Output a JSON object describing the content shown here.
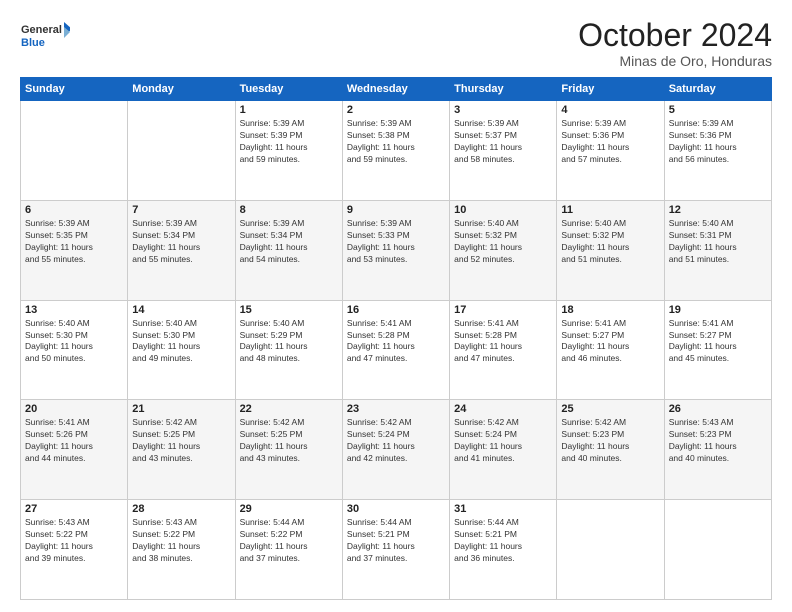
{
  "logo": {
    "line1": "General",
    "line2": "Blue"
  },
  "header": {
    "month": "October 2024",
    "location": "Minas de Oro, Honduras"
  },
  "weekdays": [
    "Sunday",
    "Monday",
    "Tuesday",
    "Wednesday",
    "Thursday",
    "Friday",
    "Saturday"
  ],
  "weeks": [
    [
      {
        "day": "",
        "content": ""
      },
      {
        "day": "",
        "content": ""
      },
      {
        "day": "1",
        "content": "Sunrise: 5:39 AM\nSunset: 5:39 PM\nDaylight: 11 hours\nand 59 minutes."
      },
      {
        "day": "2",
        "content": "Sunrise: 5:39 AM\nSunset: 5:38 PM\nDaylight: 11 hours\nand 59 minutes."
      },
      {
        "day": "3",
        "content": "Sunrise: 5:39 AM\nSunset: 5:37 PM\nDaylight: 11 hours\nand 58 minutes."
      },
      {
        "day": "4",
        "content": "Sunrise: 5:39 AM\nSunset: 5:36 PM\nDaylight: 11 hours\nand 57 minutes."
      },
      {
        "day": "5",
        "content": "Sunrise: 5:39 AM\nSunset: 5:36 PM\nDaylight: 11 hours\nand 56 minutes."
      }
    ],
    [
      {
        "day": "6",
        "content": "Sunrise: 5:39 AM\nSunset: 5:35 PM\nDaylight: 11 hours\nand 55 minutes."
      },
      {
        "day": "7",
        "content": "Sunrise: 5:39 AM\nSunset: 5:34 PM\nDaylight: 11 hours\nand 55 minutes."
      },
      {
        "day": "8",
        "content": "Sunrise: 5:39 AM\nSunset: 5:34 PM\nDaylight: 11 hours\nand 54 minutes."
      },
      {
        "day": "9",
        "content": "Sunrise: 5:39 AM\nSunset: 5:33 PM\nDaylight: 11 hours\nand 53 minutes."
      },
      {
        "day": "10",
        "content": "Sunrise: 5:40 AM\nSunset: 5:32 PM\nDaylight: 11 hours\nand 52 minutes."
      },
      {
        "day": "11",
        "content": "Sunrise: 5:40 AM\nSunset: 5:32 PM\nDaylight: 11 hours\nand 51 minutes."
      },
      {
        "day": "12",
        "content": "Sunrise: 5:40 AM\nSunset: 5:31 PM\nDaylight: 11 hours\nand 51 minutes."
      }
    ],
    [
      {
        "day": "13",
        "content": "Sunrise: 5:40 AM\nSunset: 5:30 PM\nDaylight: 11 hours\nand 50 minutes."
      },
      {
        "day": "14",
        "content": "Sunrise: 5:40 AM\nSunset: 5:30 PM\nDaylight: 11 hours\nand 49 minutes."
      },
      {
        "day": "15",
        "content": "Sunrise: 5:40 AM\nSunset: 5:29 PM\nDaylight: 11 hours\nand 48 minutes."
      },
      {
        "day": "16",
        "content": "Sunrise: 5:41 AM\nSunset: 5:28 PM\nDaylight: 11 hours\nand 47 minutes."
      },
      {
        "day": "17",
        "content": "Sunrise: 5:41 AM\nSunset: 5:28 PM\nDaylight: 11 hours\nand 47 minutes."
      },
      {
        "day": "18",
        "content": "Sunrise: 5:41 AM\nSunset: 5:27 PM\nDaylight: 11 hours\nand 46 minutes."
      },
      {
        "day": "19",
        "content": "Sunrise: 5:41 AM\nSunset: 5:27 PM\nDaylight: 11 hours\nand 45 minutes."
      }
    ],
    [
      {
        "day": "20",
        "content": "Sunrise: 5:41 AM\nSunset: 5:26 PM\nDaylight: 11 hours\nand 44 minutes."
      },
      {
        "day": "21",
        "content": "Sunrise: 5:42 AM\nSunset: 5:25 PM\nDaylight: 11 hours\nand 43 minutes."
      },
      {
        "day": "22",
        "content": "Sunrise: 5:42 AM\nSunset: 5:25 PM\nDaylight: 11 hours\nand 43 minutes."
      },
      {
        "day": "23",
        "content": "Sunrise: 5:42 AM\nSunset: 5:24 PM\nDaylight: 11 hours\nand 42 minutes."
      },
      {
        "day": "24",
        "content": "Sunrise: 5:42 AM\nSunset: 5:24 PM\nDaylight: 11 hours\nand 41 minutes."
      },
      {
        "day": "25",
        "content": "Sunrise: 5:42 AM\nSunset: 5:23 PM\nDaylight: 11 hours\nand 40 minutes."
      },
      {
        "day": "26",
        "content": "Sunrise: 5:43 AM\nSunset: 5:23 PM\nDaylight: 11 hours\nand 40 minutes."
      }
    ],
    [
      {
        "day": "27",
        "content": "Sunrise: 5:43 AM\nSunset: 5:22 PM\nDaylight: 11 hours\nand 39 minutes."
      },
      {
        "day": "28",
        "content": "Sunrise: 5:43 AM\nSunset: 5:22 PM\nDaylight: 11 hours\nand 38 minutes."
      },
      {
        "day": "29",
        "content": "Sunrise: 5:44 AM\nSunset: 5:22 PM\nDaylight: 11 hours\nand 37 minutes."
      },
      {
        "day": "30",
        "content": "Sunrise: 5:44 AM\nSunset: 5:21 PM\nDaylight: 11 hours\nand 37 minutes."
      },
      {
        "day": "31",
        "content": "Sunrise: 5:44 AM\nSunset: 5:21 PM\nDaylight: 11 hours\nand 36 minutes."
      },
      {
        "day": "",
        "content": ""
      },
      {
        "day": "",
        "content": ""
      }
    ]
  ]
}
